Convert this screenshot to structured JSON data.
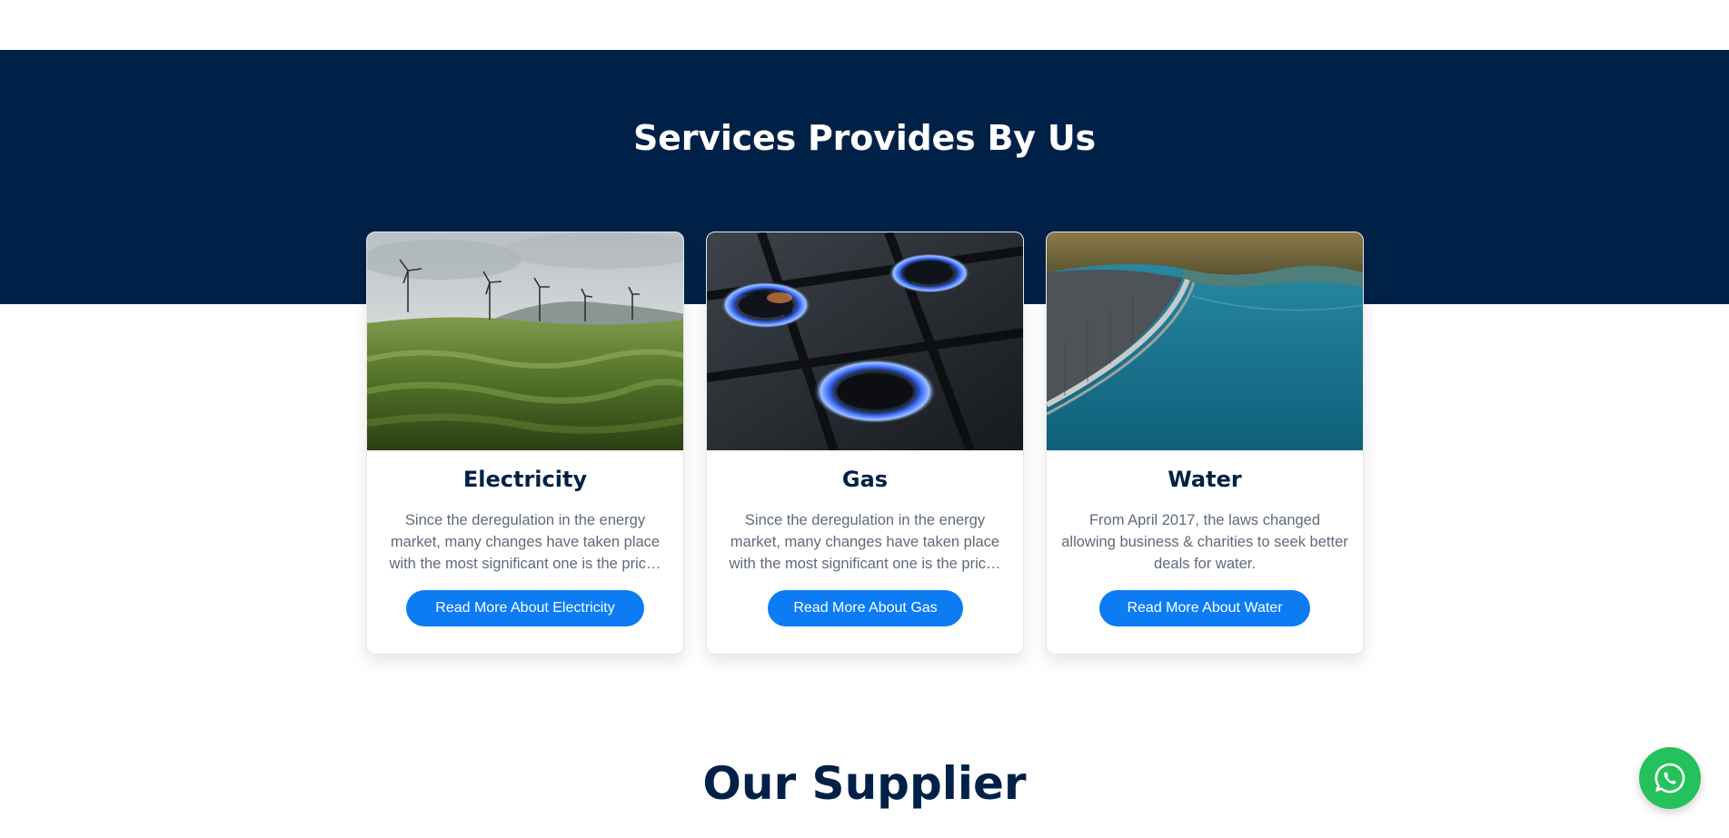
{
  "services": {
    "title": "Services Provides By Us",
    "cards": [
      {
        "title": "Electricity",
        "text": "Since the deregulation in the energy market, many changes have taken place with the most significant one is the pric…",
        "button": "Read More About Electricity",
        "image": "wind-turbines-hills-image"
      },
      {
        "title": "Gas",
        "text": "Since the deregulation in the energy market, many changes have taken place with the most significant one is the pric…",
        "button": "Read More About Gas",
        "image": "gas-stove-burners-image"
      },
      {
        "title": "Water",
        "text": "From April 2017, the laws changed allowing business & charities to seek better deals for water.",
        "button": "Read More About Water",
        "image": "dam-reservoir-image"
      }
    ]
  },
  "supplier": {
    "title": "Our Supplier"
  },
  "floating": {
    "icon": "whatsapp-icon"
  },
  "colors": {
    "navy": "#002147",
    "button_blue": "#0d7cf2",
    "whatsapp_green": "#25c15c"
  }
}
